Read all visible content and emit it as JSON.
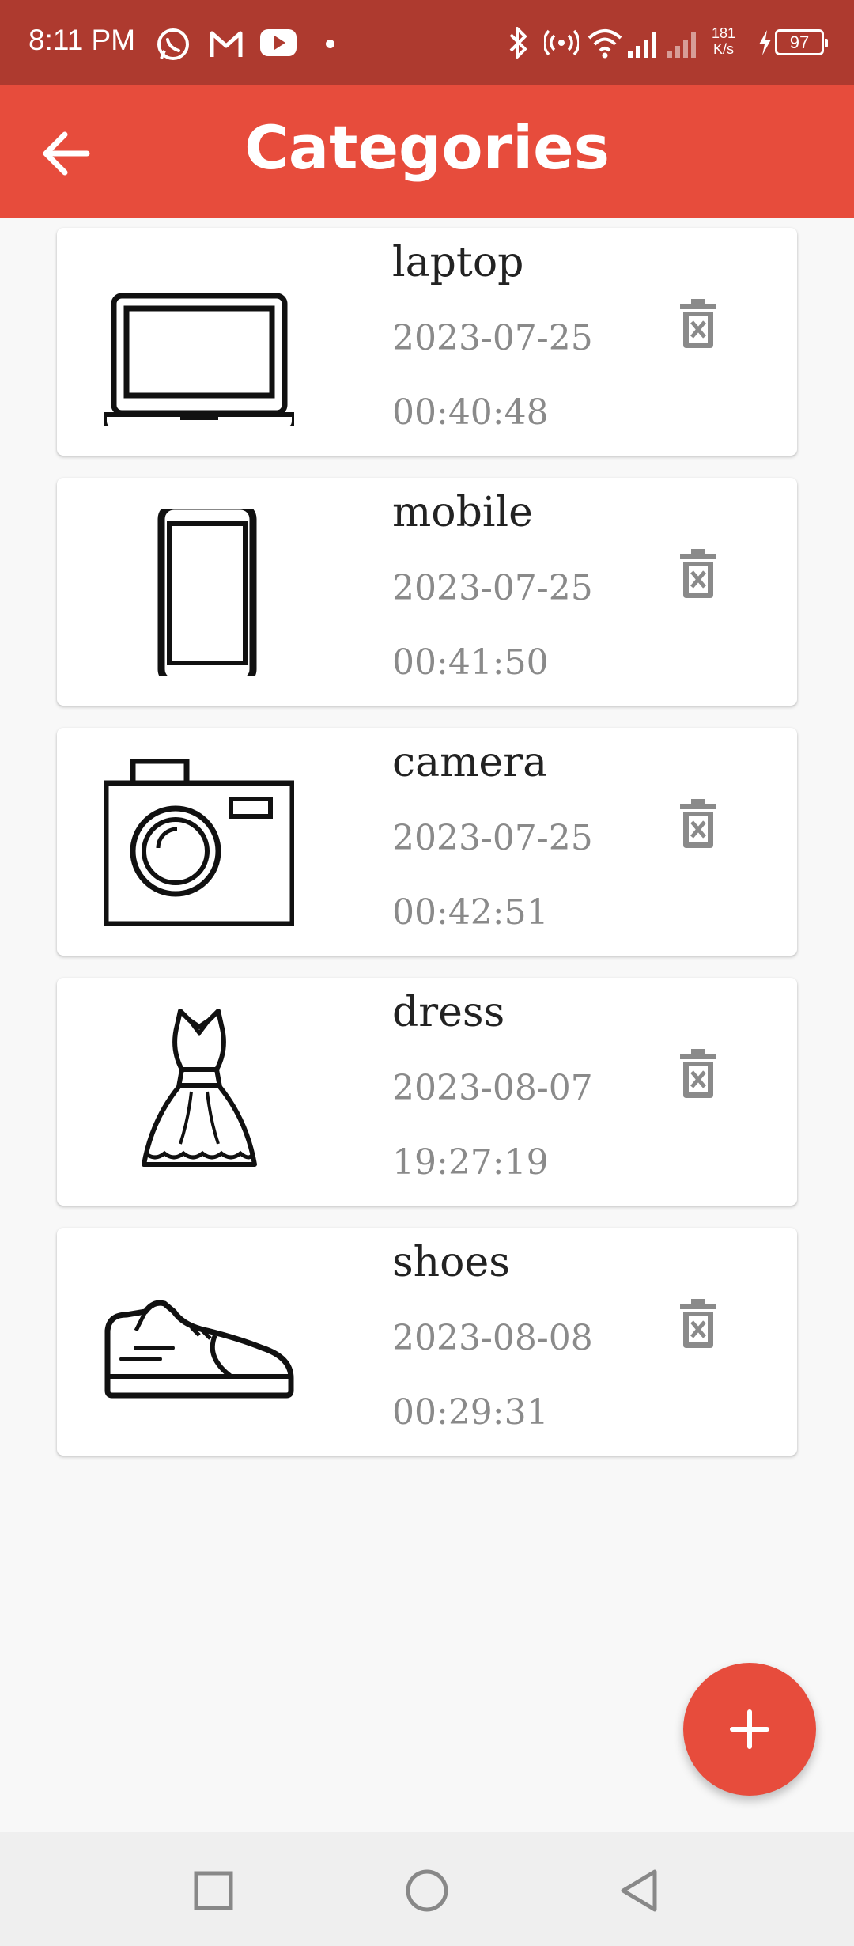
{
  "status_bar": {
    "time": "8:11 PM",
    "net_speed_value": "181",
    "net_speed_unit": "K/s",
    "battery": "97",
    "icons": [
      "whatsapp-icon",
      "gmail-icon",
      "youtube-icon",
      "notification-dot",
      "bluetooth-icon",
      "hotspot-icon",
      "wifi-icon",
      "signal-icon",
      "signal-icon-2",
      "charging-icon",
      "battery-icon"
    ]
  },
  "app_bar": {
    "title": "Categories",
    "back_icon": "arrow-left-icon"
  },
  "categories": [
    {
      "name": "laptop",
      "date": "2023-07-25",
      "time": "00:40:48",
      "icon": "laptop-icon"
    },
    {
      "name": "mobile",
      "date": "2023-07-25",
      "time": "00:41:50",
      "icon": "mobile-icon"
    },
    {
      "name": "camera",
      "date": "2023-07-25",
      "time": "00:42:51",
      "icon": "camera-icon"
    },
    {
      "name": "dress",
      "date": "2023-08-07",
      "time": "19:27:19",
      "icon": "dress-icon"
    },
    {
      "name": "shoes",
      "date": "2023-08-08",
      "time": "00:29:31",
      "icon": "sneaker-icon"
    }
  ],
  "fab": {
    "icon": "plus-icon"
  },
  "nav_bar": {
    "icons": [
      "recents-square-icon",
      "home-circle-icon",
      "back-triangle-icon"
    ]
  },
  "colors": {
    "status_bar": "#ae3a2f",
    "app_bar": "#e74c3c",
    "fab": "#e74c3c",
    "background": "#f8f8f8"
  }
}
